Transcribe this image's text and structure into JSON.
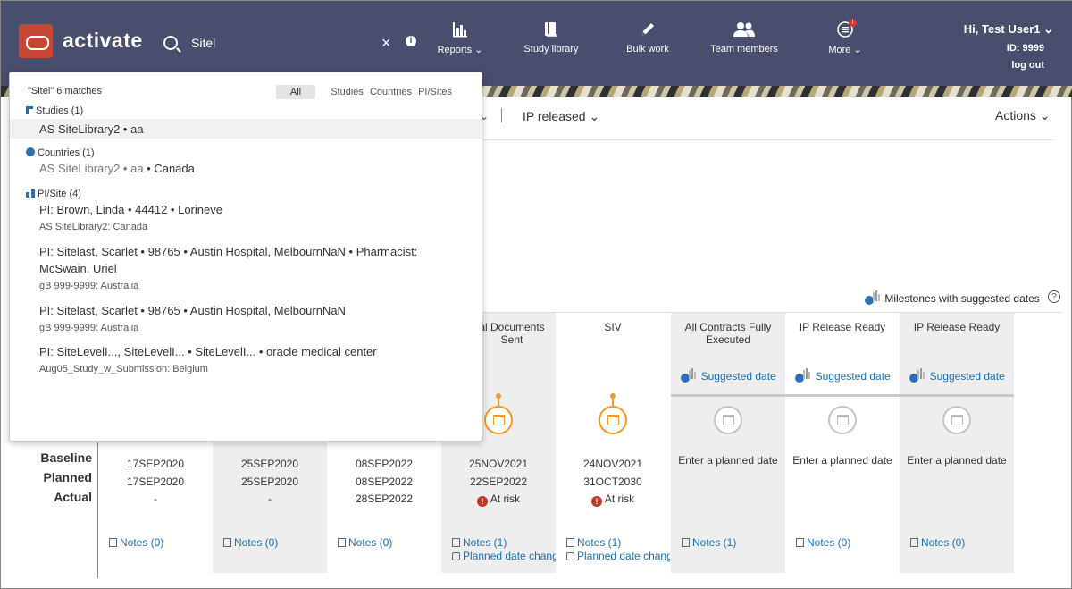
{
  "header": {
    "app_name": "activate",
    "search_value": "Sitel",
    "clear_symbol": "×",
    "info_symbol": "i",
    "nav": {
      "reports": "Reports ⌄",
      "study_library": "Study library",
      "bulk_work": "Bulk work",
      "team_members": "Team members",
      "more": "More ⌄",
      "more_badge": "!"
    },
    "user": {
      "greeting": "Hi, Test User1 ⌄",
      "id": "ID: 9999",
      "logout": "log out"
    }
  },
  "subbar": {
    "ip_released": "IP released ⌄",
    "actions": "Actions ⌄",
    "left_caret": "⌄"
  },
  "milestones": {
    "legend": "Milestones with suggested dates",
    "help": "?",
    "row_labels": [
      "Baseline",
      "Planned",
      "Actual"
    ],
    "columns": [
      {
        "title": "",
        "baseline": "17SEP2020",
        "planned": "17SEP2020",
        "actual": "-",
        "notes": "Notes (0)"
      },
      {
        "title": "",
        "baseline": "25SEP2020",
        "planned": "25SEP2020",
        "actual": "-",
        "notes": "Notes (0)"
      },
      {
        "title": "",
        "baseline": "08SEP2022",
        "planned": "08SEP2022",
        "actual": "28SEP2022",
        "notes": "Notes (0)"
      },
      {
        "title": "al Documents Sent",
        "baseline": "25NOV2021",
        "planned": "22SEP2022",
        "actual": "At risk",
        "notes": "Notes (1)",
        "planned_change": "Planned date change"
      },
      {
        "title": "SIV",
        "baseline": "24NOV2021",
        "planned": "31OCT2030",
        "actual": "At risk",
        "notes": "Notes (1)",
        "planned_change": "Planned date change"
      },
      {
        "title": "All Contracts Fully Executed",
        "suggested": "Suggested date",
        "enter_planned": "Enter a planned date",
        "notes": "Notes (1)"
      },
      {
        "title": "IP Release Ready",
        "suggested": "Suggested date",
        "enter_planned": "Enter a planned date",
        "notes": "Notes (0)"
      },
      {
        "title": "IP Release Ready",
        "suggested": "Suggested date",
        "enter_planned": "Enter a planned date",
        "notes": "Notes (0)"
      }
    ],
    "risk_symbol": "!"
  },
  "search_dropdown": {
    "summary": "\"Sitel\" 6 matches",
    "filters": [
      "All",
      "Studies",
      "Countries",
      "PI/Sites"
    ],
    "groups": {
      "studies": {
        "label": "Studies (1)",
        "results": [
          {
            "name": "AS SiteLibrary2 • aa"
          }
        ]
      },
      "countries": {
        "label": "Countries (1)",
        "results": [
          {
            "muted": "AS SiteLibrary2 • aa",
            "name": " • Canada"
          }
        ]
      },
      "sites": {
        "label": "PI/Site (4)",
        "results": [
          {
            "name": "PI: Brown, Linda • 44412 • Lorineve",
            "sub": "AS SiteLibrary2: Canada"
          },
          {
            "name": "PI: Sitelast, Scarlet • 98765 • Austin Hospital, MelbournNaN • Pharmacist: McSwain, Uriel",
            "sub": "gB 999-9999: Australia"
          },
          {
            "name": "PI: Sitelast, Scarlet • 98765 • Austin Hospital, MelbournNaN",
            "sub": "gB 999-9999: Australia"
          },
          {
            "name": "PI: SiteLevelI..., SiteLevelI... • SiteLevelI... • oracle medical center",
            "sub": "Aug05_Study_w_Submission: Belgium"
          }
        ]
      }
    }
  },
  "colors": {
    "header_bg": "#4a4e6e",
    "brand": "#c74634",
    "link": "#1a6fb8",
    "milestone_orange": "#f09a27",
    "risk_red": "#c0392b"
  }
}
